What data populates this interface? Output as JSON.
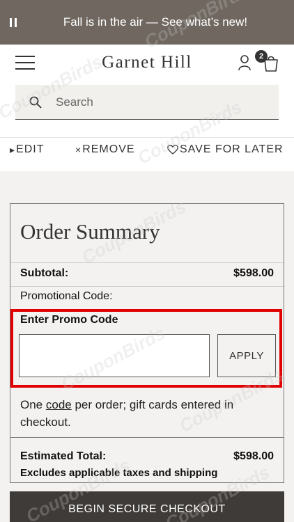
{
  "promo_bar": {
    "text": "Fall is in the air — See what’s new!"
  },
  "header": {
    "logo": "Garnet Hill",
    "bag_count": "2"
  },
  "search": {
    "placeholder": "Search"
  },
  "item_actions": {
    "edit": "EDIT",
    "remove": "REMOVE",
    "save_for_later": "SAVE FOR LATER"
  },
  "order_summary": {
    "title": "Order Summary",
    "subtotal_label": "Subtotal:",
    "subtotal_value": "$598.00",
    "promo_label": "Promotional Code:",
    "enter_promo_label": "Enter Promo Code",
    "promo_input_value": "",
    "apply_label": "APPLY",
    "note_pre": "One ",
    "note_link": "code",
    "note_post": " per order; gift cards entered in checkout.",
    "estimated_total_label": "Estimated Total:",
    "estimated_total_value": "$598.00",
    "excludes_text": "Excludes applicable taxes and shipping"
  },
  "checkout": {
    "label": "BEGIN SECURE CHECKOUT"
  },
  "watermark": {
    "text": "CouponBirds"
  },
  "colors": {
    "promo_bar_bg": "#6f6760",
    "highlight": "#e00000",
    "checkout_bg": "#3f3b38",
    "panel_bg": "#f3f2f0"
  }
}
